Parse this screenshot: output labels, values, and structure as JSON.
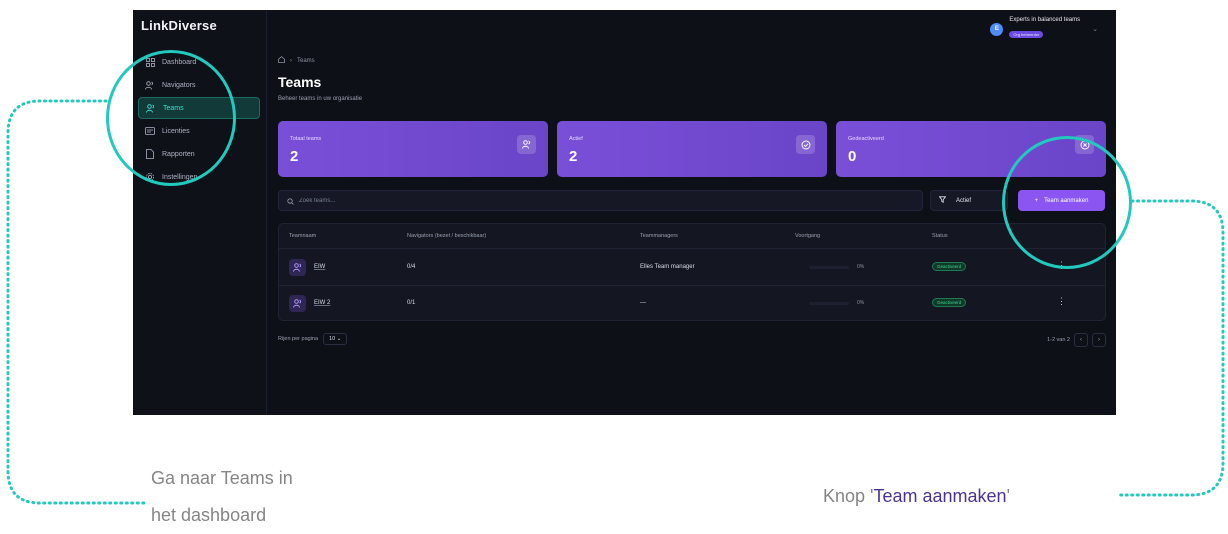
{
  "app": {
    "logo_text": "LinkDiverse"
  },
  "sidebar": {
    "items": [
      {
        "label": "Dashboard"
      },
      {
        "label": "Navigators"
      },
      {
        "label": "Teams"
      },
      {
        "label": "Licenties"
      },
      {
        "label": "Rapporten"
      },
      {
        "label": "Instellingen"
      }
    ]
  },
  "user": {
    "initial": "E",
    "name": "Experts in balanced teams",
    "badge": "Org beheerder"
  },
  "page": {
    "breadcrumb_current": "Teams",
    "title": "Teams",
    "subtitle": "Beheer teams in uw organisatie"
  },
  "stats": [
    {
      "label": "Totaal teams",
      "value": "2"
    },
    {
      "label": "Actief",
      "value": "2"
    },
    {
      "label": "Gedeactiveerd",
      "value": "0"
    }
  ],
  "toolbar": {
    "search_placeholder": "Zoek teams...",
    "filter_value": "Actief",
    "create_label": "Team aanmaken"
  },
  "table": {
    "headers": [
      "Teamnaam",
      "Navigators (bezet / beschikbaar)",
      "Teammanagers",
      "Voortgang",
      "Status"
    ],
    "rows": [
      {
        "name": "EIW",
        "navigators": "0/4",
        "managers": "Elles Team manager",
        "progress": 0,
        "progress_text": "0%",
        "status": "Geactiveerd"
      },
      {
        "name": "EIW 2",
        "navigators": "0/1",
        "managers": "—",
        "progress": 0,
        "progress_text": "0%",
        "status": "Geactiveerd"
      }
    ]
  },
  "pagination": {
    "rows_label": "Rijen per pagina",
    "rows_value": "10",
    "range": "1-2 van 2"
  },
  "annotations": {
    "left_caption_line1": "Ga naar Teams in",
    "left_caption_line2": "het dashboard",
    "right_caption_prefix": "Knop '",
    "right_caption_highlight": "Team aanmaken",
    "right_caption_suffix": "'",
    "ring_color": "#22c9bd",
    "highlight_color": "#4b3491"
  }
}
